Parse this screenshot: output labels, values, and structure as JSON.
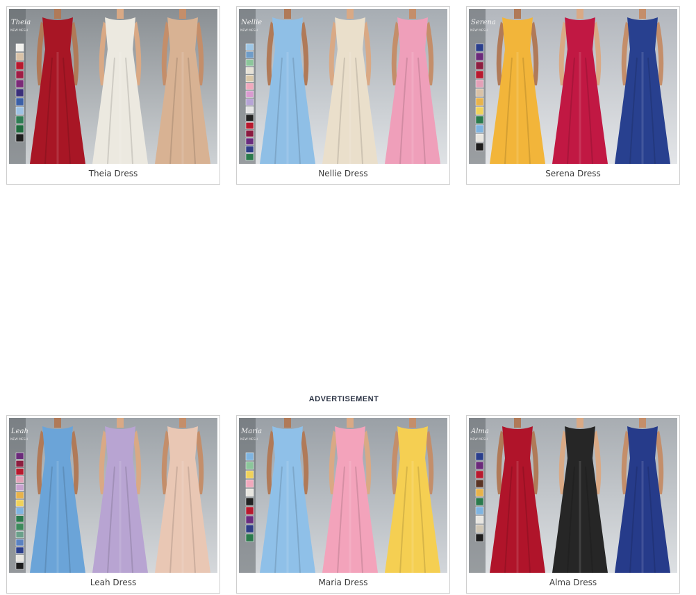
{
  "advertisement_label": "ADVERTISEMENT",
  "cards": [
    {
      "name": "Theia Dress",
      "thumb_title": "Theia",
      "thumb_subtitle": "NEW MESH",
      "bg_top": "#8a8f93",
      "bg_bottom": "#cdd1d4",
      "swatches": [
        "#f2f2ee",
        "#d9c2a7",
        "#b8192e",
        "#a01c45",
        "#7c2a78",
        "#3b2f7a",
        "#3b5fa7",
        "#9ec2e4",
        "#2f7d54",
        "#1f6b3e",
        "#1d1d1d"
      ],
      "dresses": [
        "#a81625",
        "#ece9e0",
        "#d8b293"
      ]
    },
    {
      "name": "Nellie Dress",
      "thumb_title": "Nellie",
      "thumb_subtitle": "NEW MESH",
      "bg_top": "#a7adb3",
      "bg_bottom": "#dfe2e5",
      "swatches": [
        "#9ec7e6",
        "#6f9cc8",
        "#8cc69b",
        "#e7e2d6",
        "#d9c7a8",
        "#f1a9bd",
        "#d99bd0",
        "#b6a4d6",
        "#e4e4e4",
        "#222222",
        "#b8192e",
        "#8b1a40",
        "#6a2c7e",
        "#2f3d87",
        "#2a7a4c"
      ],
      "dresses": [
        "#8fbfe6",
        "#eadfcb",
        "#ef9fba"
      ]
    },
    {
      "name": "Serena Dress",
      "thumb_title": "Serena",
      "thumb_subtitle": "NEW MESH",
      "bg_top": "#b3b7bd",
      "bg_bottom": "#e3e5e8",
      "swatches": [
        "#2a3e8c",
        "#6b2a7a",
        "#8d1e40",
        "#b8192e",
        "#e3a1b8",
        "#d9c2a7",
        "#e8b34a",
        "#f0d25a",
        "#2a7a4c",
        "#7fb4e0",
        "#e8e6e0",
        "#1d1d1d"
      ],
      "dresses": [
        "#f2b53a",
        "#c11843",
        "#28408f"
      ]
    },
    {
      "name": "Leah Dress",
      "thumb_title": "Leah",
      "thumb_subtitle": "NEW MESH",
      "bg_top": "#9ca2a7",
      "bg_bottom": "#d5d8db",
      "swatches": [
        "#6b2a7a",
        "#8d1e40",
        "#b8192e",
        "#e3a1b8",
        "#c8a2cf",
        "#e8b34a",
        "#f0d25a",
        "#7fb4e0",
        "#2a7a4c",
        "#3d8a5c",
        "#6aa08a",
        "#5b82c2",
        "#2a3e8c",
        "#e8e6e0",
        "#1d1d1d"
      ],
      "dresses": [
        "#6ba4d8",
        "#b8a4d2",
        "#e9c7b4"
      ]
    },
    {
      "name": "Maria Dress",
      "thumb_title": "Maria",
      "thumb_subtitle": "NEW MESH",
      "bg_top": "#9aa0a6",
      "bg_bottom": "#d2d6da",
      "swatches": [
        "#7fb4e0",
        "#8cc69b",
        "#f0d25a",
        "#f1a9bd",
        "#e8e6e0",
        "#222222",
        "#b8192e",
        "#6a2c7e",
        "#2f3d87",
        "#2a7a4c"
      ],
      "dresses": [
        "#8fc0e8",
        "#f3a3bb",
        "#f5cf52"
      ]
    },
    {
      "name": "Alma Dress",
      "thumb_title": "Alma",
      "thumb_subtitle": "NEW MESH",
      "bg_top": "#a8adb2",
      "bg_bottom": "#dde0e3",
      "swatches": [
        "#2a3e8c",
        "#6b2a7a",
        "#b8192e",
        "#5a3424",
        "#e8b34a",
        "#2a7a4c",
        "#7fb4e0",
        "#e8e6e0",
        "#cfc6b4",
        "#1d1d1d"
      ],
      "dresses": [
        "#b0142a",
        "#262626",
        "#263b8a"
      ]
    }
  ]
}
